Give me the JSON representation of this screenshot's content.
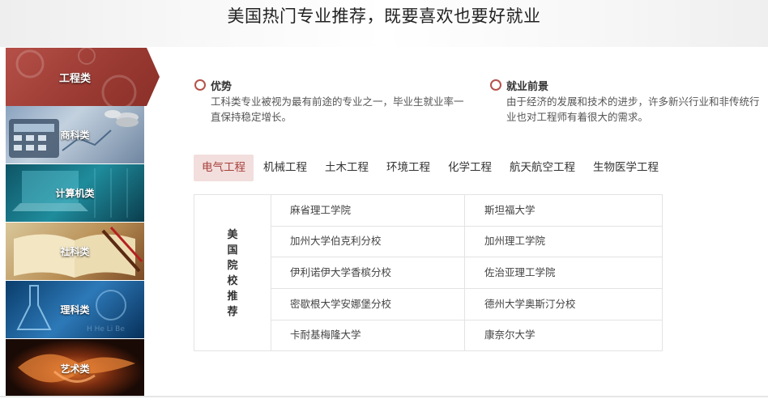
{
  "page": {
    "title": "美国热门专业推荐，既要喜欢也要好就业"
  },
  "sidebar": {
    "categories": [
      {
        "label": "工程类",
        "active": true
      },
      {
        "label": "商科类",
        "active": false
      },
      {
        "label": "计算机类",
        "active": false
      },
      {
        "label": "社科类",
        "active": false
      },
      {
        "label": "理科类",
        "active": false
      },
      {
        "label": "艺术类",
        "active": false
      }
    ]
  },
  "info": {
    "advantage": {
      "title": "优势",
      "text": "工科类专业被视为最有前途的专业之一，毕业生就业率一直保持稳定增长。"
    },
    "prospect": {
      "title": "就业前景",
      "text": "由于经济的发展和技术的进步，许多新兴行业和非传统行业也对工程师有着很大的需求。"
    }
  },
  "tabs": [
    "电气工程",
    "机械工程",
    "土木工程",
    "环境工程",
    "化学工程",
    "航天航空工程",
    "生物医学工程"
  ],
  "active_tab": "电气工程",
  "table": {
    "header": "美国院校推荐",
    "rows": [
      [
        "麻省理工学院",
        "斯坦福大学"
      ],
      [
        "加州大学伯克利分校",
        "加州理工学院"
      ],
      [
        "伊利诺伊大学香槟分校",
        "佐治亚理工学院"
      ],
      [
        "密歇根大学安娜堡分校",
        "德州大学奥斯汀分校"
      ],
      [
        "卡耐基梅隆大学",
        "康奈尔大学"
      ]
    ]
  },
  "colors": {
    "accent": "#b5524a",
    "active_tab_bg": "#f2dedd",
    "active_tab_text": "#a8403a"
  }
}
